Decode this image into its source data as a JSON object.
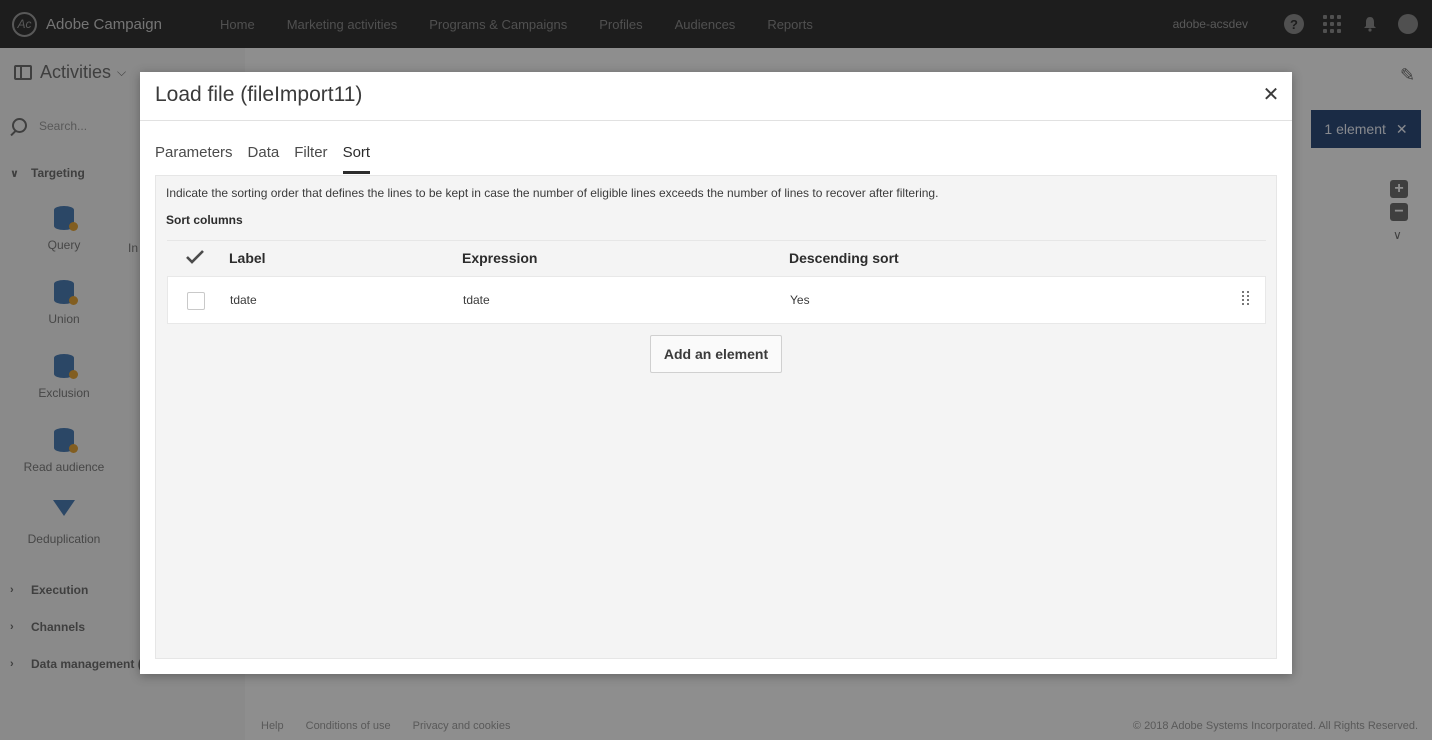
{
  "app": {
    "brand": "Adobe Campaign",
    "nav": [
      "Home",
      "Marketing activities",
      "Programs & Campaigns",
      "Profiles",
      "Audiences",
      "Reports"
    ],
    "user": "adobe-acsdev"
  },
  "background": {
    "activities_label": "Activities",
    "search_placeholder": "Search...",
    "sections": {
      "targeting": "Targeting",
      "execution": "Execution",
      "channels": "Channels",
      "data_management": "Data management ("
    },
    "tiles": [
      "Query",
      "Union",
      "Exclusion",
      "Read audience",
      "Deduplication"
    ],
    "tile_partial": "In",
    "canvas_title": "",
    "selection_pill": "1 element",
    "footer_links": [
      "Help",
      "Conditions of use",
      "Privacy and cookies"
    ],
    "copyright": "© 2018 Adobe Systems Incorporated. All Rights Reserved."
  },
  "modal": {
    "title": "Load file (fileImport11)",
    "tabs": [
      {
        "label": "Parameters",
        "active": false
      },
      {
        "label": "Data",
        "active": false
      },
      {
        "label": "Filter",
        "active": false
      },
      {
        "label": "Sort",
        "active": true
      }
    ],
    "description": "Indicate the sorting order that defines the lines to be kept in case the number of eligible lines exceeds the number of lines to recover after filtering.",
    "sort_columns_label": "Sort columns",
    "table": {
      "headers": {
        "label": "Label",
        "expression": "Expression",
        "descending": "Descending sort"
      },
      "rows": [
        {
          "label": "tdate",
          "expression": "tdate",
          "descending": "Yes",
          "checked": false
        }
      ]
    },
    "add_button": "Add an element"
  },
  "colors": {
    "topbar": "#323232",
    "selection_pill": "#2d4a78",
    "activity_icon": "#4a7ab0"
  }
}
